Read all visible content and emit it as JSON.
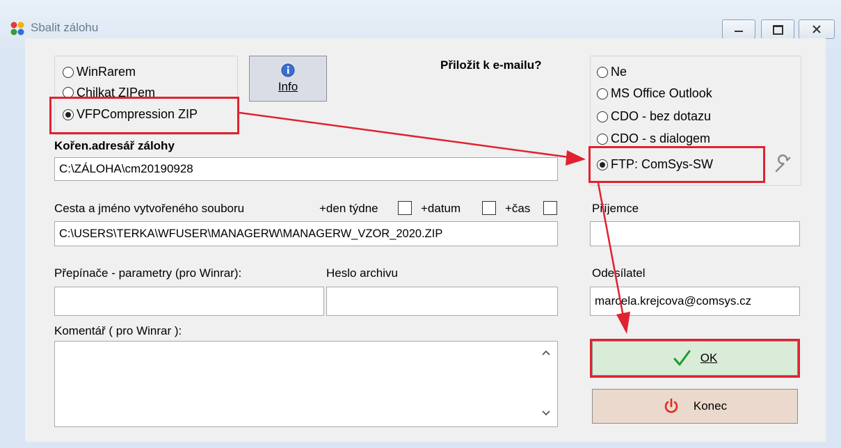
{
  "window": {
    "title": "Sbalit zálohu",
    "controls": [
      "minimize",
      "maximize",
      "close"
    ]
  },
  "compression": {
    "options": [
      {
        "label": "WinRarem",
        "selected": false
      },
      {
        "label": "Chilkat ZIPem",
        "selected": false
      },
      {
        "label": "VFPCompression ZIP",
        "selected": true
      }
    ]
  },
  "info_button": {
    "label": "Info",
    "icon": "info-icon"
  },
  "email": {
    "question": "Přiložit k e-mailu?",
    "options": [
      {
        "label": "Ne",
        "selected": false
      },
      {
        "label": "MS Office Outlook",
        "selected": false
      },
      {
        "label": "CDO - bez dotazu",
        "selected": false
      },
      {
        "label": "CDO - s dialogem",
        "selected": false
      },
      {
        "label": "FTP: ComSys-SW",
        "selected": true
      }
    ],
    "settings_icon": "wrench-icon"
  },
  "root_dir": {
    "label": "Kořen.adresář zálohy",
    "value": "C:\\ZÁLOHA\\cm20190928"
  },
  "file_path": {
    "label": "Cesta a jméno vytvořeného  souboru",
    "weekday_label": "+den týdne",
    "date_label": "+datum",
    "time_label": "+čas",
    "weekday_checked": false,
    "date_checked": false,
    "time_checked": false,
    "value": "C:\\USERS\\TERKA\\WFUSER\\MANAGERW\\MANAGERW_VZOR_2020.ZIP"
  },
  "recipient": {
    "label": "Příjemce",
    "value": ""
  },
  "switches": {
    "label": "Přepínače - parametry (pro Winrar):",
    "value": ""
  },
  "archive_password": {
    "label": "Heslo archivu",
    "value": ""
  },
  "sender": {
    "label": "Odesílatel",
    "value": "marcela.krejcova@comsys.cz"
  },
  "comment": {
    "label": "Komentář ( pro Winrar ):",
    "value": ""
  },
  "ok_button": {
    "label": "OK",
    "icon": "checkmark-icon",
    "bg": "#d8ecd8"
  },
  "exit_button": {
    "label": "Konec",
    "icon": "power-icon",
    "bg": "#ead9cc"
  },
  "annotation_color": "#e0222f"
}
